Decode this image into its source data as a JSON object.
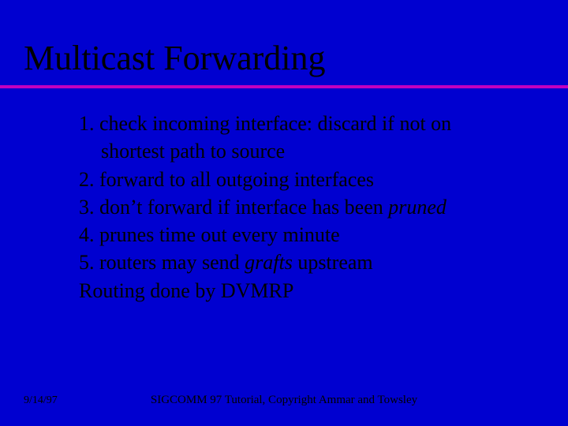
{
  "title": "Multicast Forwarding",
  "items": {
    "i1a": "1. check incoming interface: discard if not on",
    "i1b": "shortest path to source",
    "i2": "2. forward to all outgoing interfaces",
    "i3a": "3. don’t forward if interface has been ",
    "i3b": "pruned",
    "i4": "4. prunes time out every minute",
    "i5a": "5. routers may send ",
    "i5b": "grafts",
    "i5c": " upstream",
    "i6": "Routing done by DVMRP"
  },
  "footer": {
    "date": "9/14/97",
    "copyright": "SIGCOMM 97 Tutorial, Copyright Ammar and Towsley"
  }
}
